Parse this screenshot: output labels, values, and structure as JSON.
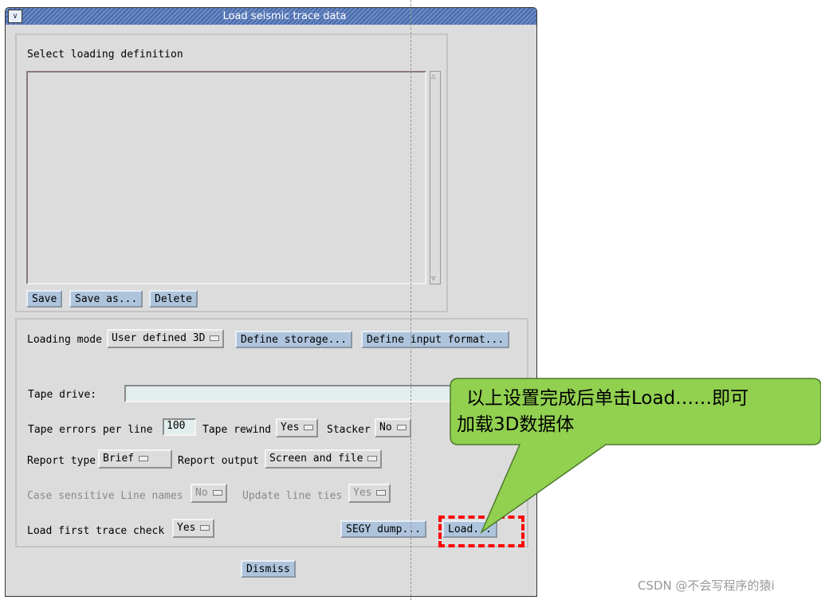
{
  "window": {
    "title": "Load seismic trace data"
  },
  "definition": {
    "label": "Select loading definition",
    "save": "Save",
    "save_as": "Save as...",
    "delete": "Delete"
  },
  "form": {
    "loading_mode_label": "Loading mode",
    "loading_mode": "User defined 3D",
    "define_storage": "Define storage...",
    "define_input_format": "Define input format...",
    "tape_drive_label": "Tape drive:",
    "tape_drive_value": "",
    "tape_errors_label": "Tape errors per line",
    "tape_errors_value": "100",
    "tape_rewind_label": "Tape rewind",
    "tape_rewind": "Yes",
    "stacker_label": "Stacker",
    "stacker": "No",
    "report_type_label": "Report type",
    "report_type": "Brief",
    "report_output_label": "Report output",
    "report_output": "Screen and file",
    "case_sensitive_label": "Case sensitive Line names",
    "case_sensitive": "No",
    "update_ties_label": "Update line ties",
    "update_ties": "Yes",
    "load_first_label": "Load first trace check",
    "load_first": "Yes",
    "segy_dump": "SEGY dump...",
    "load": "Load..."
  },
  "dismiss": "Dismiss",
  "callout": {
    "line1": "以上设置完成后单击Load……即可",
    "line2": "加载3D数据体",
    "color": "#92d050",
    "highlight_color": "#ff0000"
  },
  "watermark": "CSDN @不会写程序的猿i"
}
